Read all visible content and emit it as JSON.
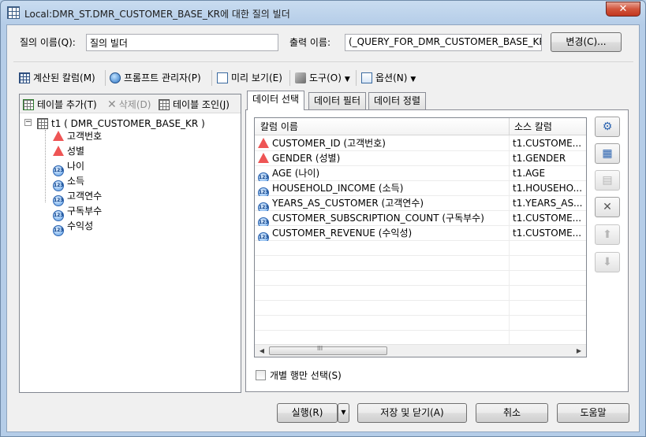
{
  "window": {
    "title": "Local:DMR_ST.DMR_CUSTOMER_BASE_KR에 대한 질의 빌더",
    "close_label": "✕"
  },
  "query_name": {
    "label": "질의 이름(Q):",
    "value": "질의 빌더"
  },
  "output_name": {
    "label": "출력 이름:",
    "value": "(_QUERY_FOR_DMR_CUSTOMER_BASE_KR",
    "change_button": "변경(C)..."
  },
  "toolbar": {
    "computed_column": "계산된 칼럼(M)",
    "prompt_manager": "프롬프트 관리자(P)",
    "preview": "미리 보기(E)",
    "tools": "도구(O)",
    "options": "옵션(N)"
  },
  "left_toolbar": {
    "add_table": "테이블 추가(T)",
    "delete": "삭제(D)",
    "join_table": "테이블 조인(J)"
  },
  "tree": {
    "table": "t1 ( DMR_CUSTOMER_BASE_KR )",
    "columns": [
      {
        "label": "고객번호",
        "icon": "warning-icon"
      },
      {
        "label": "성별",
        "icon": "warning-icon"
      },
      {
        "label": "나이",
        "icon": "numeric-icon"
      },
      {
        "label": "소득",
        "icon": "numeric-icon"
      },
      {
        "label": "고객연수",
        "icon": "numeric-icon"
      },
      {
        "label": "구독부수",
        "icon": "numeric-icon"
      },
      {
        "label": "수익성",
        "icon": "numeric-icon"
      }
    ]
  },
  "tabs": [
    {
      "label": "데이터 선택",
      "active": true
    },
    {
      "label": "데이터 필터",
      "active": false
    },
    {
      "label": "데이터 정렬",
      "active": false
    }
  ],
  "grid": {
    "headers": [
      "칼럼 이름",
      "소스 칼럼"
    ],
    "rows": [
      {
        "name": "CUSTOMER_ID (고객번호)",
        "source": "t1.CUSTOME...",
        "icon": "warning-icon"
      },
      {
        "name": "GENDER (성별)",
        "source": "t1.GENDER",
        "icon": "warning-icon"
      },
      {
        "name": "AGE (나이)",
        "source": "t1.AGE",
        "icon": "numeric-icon"
      },
      {
        "name": "HOUSEHOLD_INCOME (소득)",
        "source": "t1.HOUSEHO...",
        "icon": "numeric-icon"
      },
      {
        "name": "YEARS_AS_CUSTOMER (고객연수)",
        "source": "t1.YEARS_AS...",
        "icon": "numeric-icon"
      },
      {
        "name": "CUSTOMER_SUBSCRIPTION_COUNT (구독부수)",
        "source": "t1.CUSTOME...",
        "icon": "numeric-icon"
      },
      {
        "name": "CUSTOMER_REVENUE (수익성)",
        "source": "t1.CUSTOME...",
        "icon": "numeric-icon"
      }
    ],
    "scroll_grip": "III"
  },
  "distinct_checkbox": {
    "label": "개별 행만 선택(S)",
    "checked": false
  },
  "footer": {
    "run": "실행(R)",
    "save_close": "저장 및 닫기(A)",
    "cancel": "취소",
    "help": "도움말"
  },
  "colors": {
    "accent": "#2b63b0",
    "warning": "#e55555",
    "close": "#c2371f"
  }
}
